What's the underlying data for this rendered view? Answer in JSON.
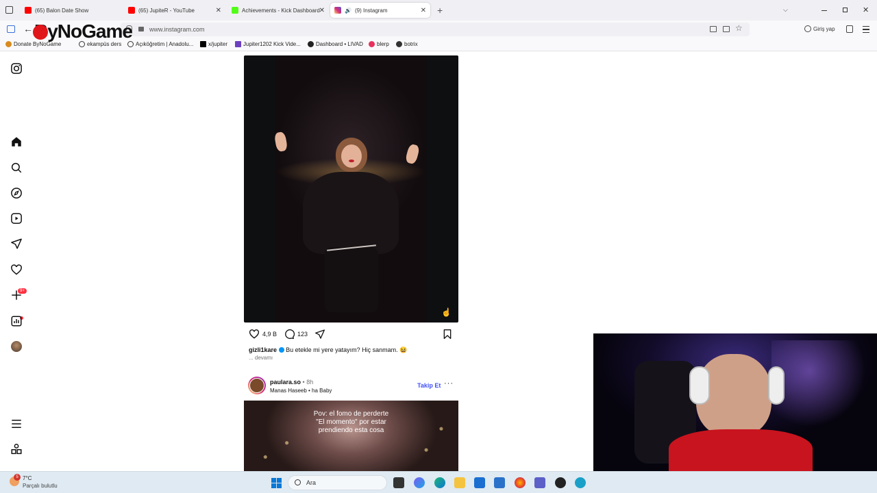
{
  "browser": {
    "tabs": [
      {
        "title": "(65) Balon Date Show",
        "active": false
      },
      {
        "title": "(65) JupiteR - YouTube",
        "active": false
      },
      {
        "title": "Achievements - Kick Dashboard",
        "active": false
      },
      {
        "title": "(9) Instagram",
        "active": true
      }
    ],
    "url": "www.instagram.com",
    "sign_in": "Giriş yap",
    "bookmarks": [
      "Donate ByNoGame",
      "ekampüs ders",
      "Açıköğretim | Anadolu...",
      "x/jupiter",
      "Jupiter1202 Kick Vide...",
      "Dashboard • LIVAD",
      "blerp",
      "botrix"
    ]
  },
  "overlay_logo": {
    "text": "ByNoGame"
  },
  "instagram": {
    "notifications_badge": "9+",
    "post1": {
      "likes": "4,9 B",
      "comments": "123",
      "username": "gizli1kare",
      "caption": "Bu etekle mi yere yatayım? Hiç sanmam. 😆",
      "more": "... devamı"
    },
    "post2": {
      "username": "paulara.so",
      "time": "8h",
      "audio": "Manas Haseeb • ha Baby",
      "follow": "Takip Et",
      "overlay_lines": [
        "Pov: el fomo de perderte",
        "\"El momento\" por estar",
        "prendiendo esta cosa"
      ]
    }
  },
  "taskbar": {
    "weather_badge": "5",
    "temperature": "7°C",
    "weather": "Parçalı bulutlu",
    "search": "Ara"
  },
  "colors": {
    "accent": "#0095f6",
    "badge": "#ff3040",
    "follow": "#4150f7"
  }
}
